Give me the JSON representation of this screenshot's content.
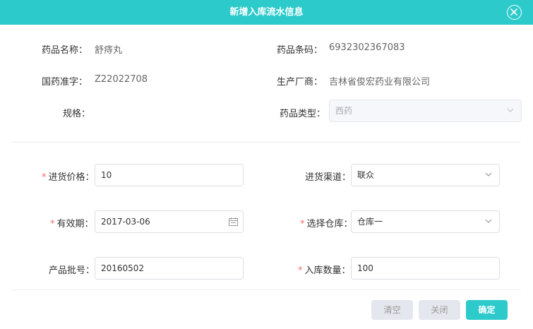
{
  "dialog": {
    "title": "新增入库流水信息"
  },
  "info": {
    "name_label": "药品名称：",
    "name_value": "舒痔丸",
    "barcode_label": "药品条码：",
    "barcode_value": "6932302367083",
    "approval_label": "国药准字：",
    "approval_value": "Z22022708",
    "maker_label": "生产厂商：",
    "maker_value": "吉林省俊宏药业有限公司",
    "spec_label": "规格：",
    "type_label": "药品类型：",
    "type_value": "西药"
  },
  "form": {
    "price_label": "进货价格：",
    "price_value": "10",
    "channel_label": "进货渠道：",
    "channel_value": "联众",
    "expiry_label": "有效期：",
    "expiry_value": "2017-03-06",
    "warehouse_label": "选择仓库：",
    "warehouse_value": "仓库一",
    "batch_label": "产品批号：",
    "batch_value": "20160502",
    "qty_label": "入库数量：",
    "qty_value": "100",
    "required_mark": "*"
  },
  "footer": {
    "clear_label": "清空",
    "close_label": "关闭",
    "confirm_label": "确定"
  },
  "colors": {
    "accent": "#2dcacb",
    "required": "#f56c6c",
    "disabled_bg": "#e4e7ed"
  },
  "icons": [
    "close-icon",
    "chevron-down-icon",
    "calendar-icon"
  ]
}
